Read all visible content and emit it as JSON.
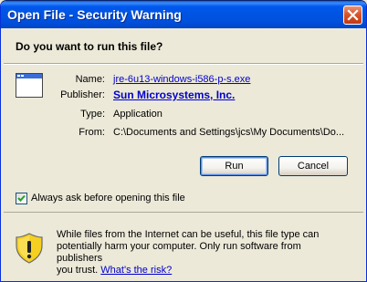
{
  "window": {
    "title": "Open File - Security Warning",
    "question": "Do you want to run this file?"
  },
  "details": {
    "name_label": "Name:",
    "name_value": "jre-6u13-windows-i586-p-s.exe",
    "publisher_label": "Publisher:",
    "publisher_value": "Sun Microsystems, Inc.",
    "type_label": "Type:",
    "type_value": "Application",
    "from_label": "From:",
    "from_value": "C:\\Documents and Settings\\jcs\\My Documents\\Do..."
  },
  "buttons": {
    "run": "Run",
    "cancel": "Cancel"
  },
  "checkbox": {
    "label": "Always ask before opening this file",
    "checked": true
  },
  "warning": {
    "line1": "While files from the Internet can be useful, this file type can",
    "line2": "potentially harm your computer. Only run software from publishers",
    "line3_prefix": "you trust. ",
    "risk_link": "What's the risk?"
  },
  "colors": {
    "titlebar": "#0054E3",
    "face": "#ECE9D8",
    "link": "#0000CC",
    "close": "#D9552B",
    "shield": "#F5D020"
  },
  "icons": [
    "close-icon",
    "application-icon",
    "checkmark-icon",
    "warning-shield-icon"
  ]
}
